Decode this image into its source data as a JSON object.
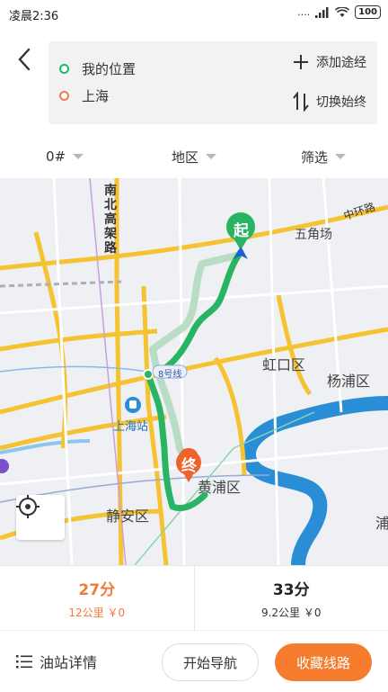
{
  "status": {
    "time": "凌晨2:36",
    "battery": "100",
    "signal": "...."
  },
  "header": {
    "origin": "我的位置",
    "destination": "上海",
    "add_waypoint": "添加途经",
    "swap": "切换始终"
  },
  "filters": [
    {
      "label": "0#"
    },
    {
      "label": "地区"
    },
    {
      "label": "筛选"
    }
  ],
  "map": {
    "start_marker": "起",
    "end_marker": "终",
    "labels": {
      "road_north_south": "南北高架路",
      "inner_ring": "中环路",
      "wujiaochang": "五角场",
      "hongkou": "虹口区",
      "yangpu": "杨浦区",
      "shanghai_station": "上海站",
      "huangpu": "黄浦区",
      "jingan": "静安区",
      "metro_8": "8号线",
      "pudong_fragment": "浦"
    },
    "colors": {
      "route_main": "#28b463",
      "route_alt": "#b8dcc4",
      "river": "#2a8ed6"
    }
  },
  "routes": [
    {
      "time": "27分",
      "meta": "12公里 ￥0",
      "selected": true
    },
    {
      "time": "33分",
      "meta": "9.2公里 ￥0",
      "selected": false
    }
  ],
  "bottom": {
    "details": "油站详情",
    "start_nav": "开始导航",
    "save_route": "收藏线路"
  }
}
